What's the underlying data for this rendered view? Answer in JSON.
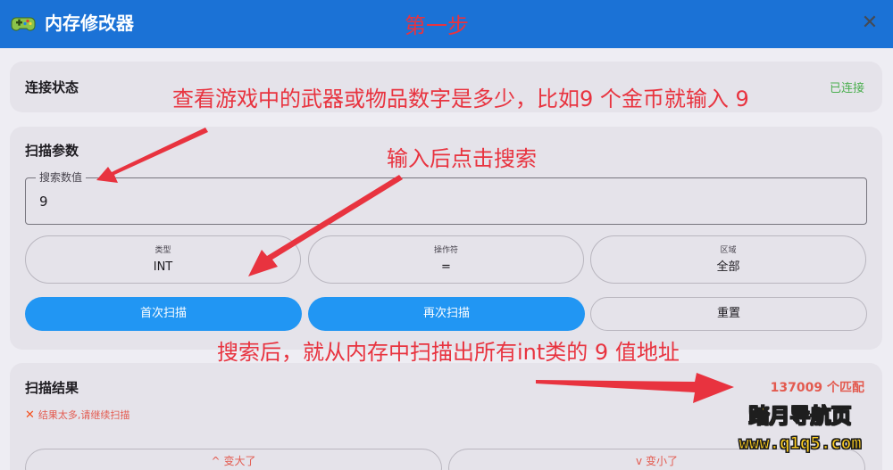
{
  "app": {
    "title": "内存修改器",
    "icon": "gamepad-icon",
    "close_icon": "close-icon",
    "close_glyph": "✕"
  },
  "connection": {
    "title": "连接状态",
    "status": "已连接",
    "status_color": "#4caf50"
  },
  "scan_params": {
    "title": "扫描参数",
    "search_label": "搜索数值",
    "search_value": "9",
    "type": {
      "label": "类型",
      "value": "INT"
    },
    "operator": {
      "label": "操作符",
      "value": "="
    },
    "region": {
      "label": "区域",
      "value": "全部"
    },
    "buttons": {
      "first_scan": "首次扫描",
      "next_scan": "再次扫描",
      "reset": "重置"
    }
  },
  "results": {
    "title": "扫描结果",
    "match_count": "137009 个匹配",
    "warning_icon": "✕",
    "warning": "结果太多,请继续扫描",
    "increase": "变大了",
    "increase_icon": "chevron-up-icon",
    "increase_glyph": "^",
    "decrease": "变小了",
    "decrease_icon": "chevron-down-icon",
    "decrease_glyph": "v"
  },
  "annotations": {
    "step": "第一步",
    "check_value": "查看游戏中的武器或物品数字是多少，比如9 个金币就输入 9",
    "click_search": "输入后点击搜索",
    "after_search": "搜索后，就从内存中扫描出所有int类的 9 值地址"
  },
  "watermark": {
    "name": "踏月导航页",
    "url": "www.q1q5.com"
  },
  "colors": {
    "titlebar": "#1b72d6",
    "primary": "#2196f3",
    "annotation": "#e8333f",
    "match": "#e35a4f"
  }
}
